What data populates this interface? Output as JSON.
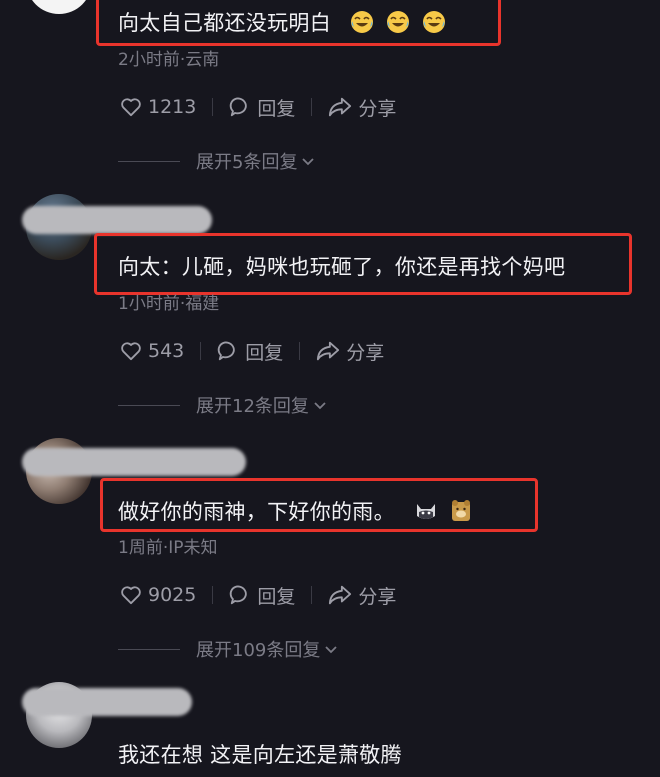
{
  "comments": [
    {
      "text": "向太自己都还没玩明白",
      "emojis": [
        "tears-of-joy",
        "tears-of-joy",
        "tears-of-joy"
      ],
      "meta": "2小时前·云南",
      "likes": "1213",
      "reply_label": "回复",
      "share_label": "分享",
      "expand_label": "展开5条回复"
    },
    {
      "text": "向太：儿砸，妈咪也玩砸了，你还是再找个妈吧",
      "meta": "1小时前·福建",
      "likes": "543",
      "reply_label": "回复",
      "share_label": "分享",
      "expand_label": "展开12条回复"
    },
    {
      "text": "做好你的雨神，下好你的雨。",
      "emojis": [
        "cat-face",
        "bear-face"
      ],
      "meta": "1周前·IP未知",
      "likes": "9025",
      "reply_label": "回复",
      "share_label": "分享",
      "expand_label": "展开109条回复"
    },
    {
      "text": "我还在想 这是向左还是萧敬腾"
    }
  ],
  "colors": {
    "background": "#16161e",
    "highlight_border": "#e8342c",
    "meta_text": "#7b7b86",
    "action_text": "#9d9da7"
  }
}
